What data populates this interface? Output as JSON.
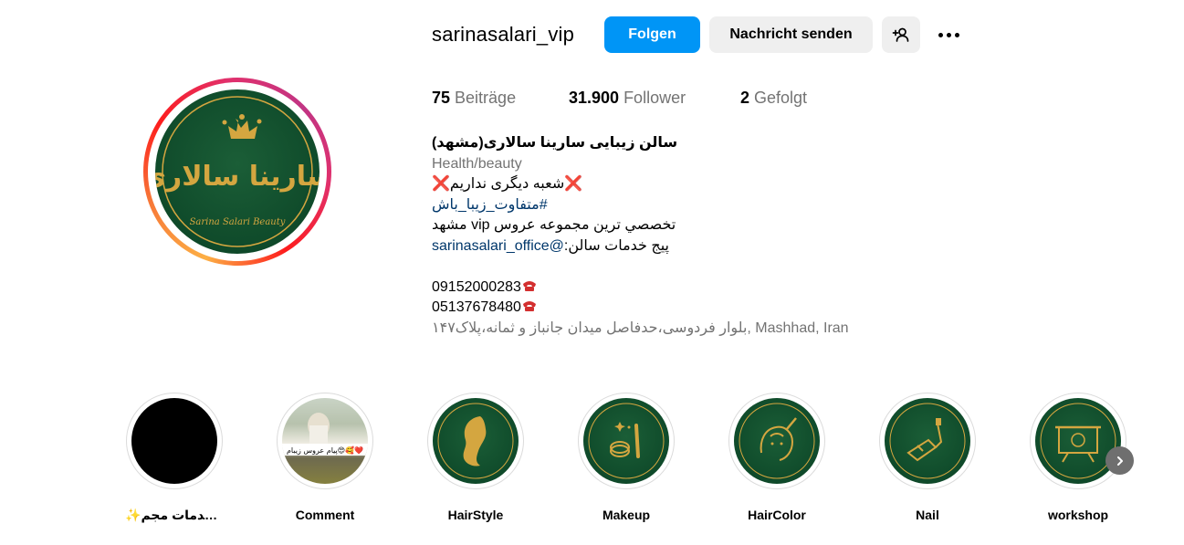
{
  "profile": {
    "username": "sarinasalari_vip",
    "follow_label": "Folgen",
    "message_label": "Nachricht senden",
    "suggest_icon": "person-plus-icon",
    "more_icon": "more-horizontal-icon",
    "avatar_text": "سارینا سالاری",
    "avatar_subtext": "Sarina Salari Beauty"
  },
  "stats": {
    "posts_count": "75",
    "posts_label": "Beiträge",
    "followers_count": "31.900",
    "followers_label": "Follower",
    "following_count": "2",
    "following_label": "Gefolgt"
  },
  "bio": {
    "name": "سالن زیبایی سارینا سالاری(مشهد)",
    "category": "Health/beauty",
    "line1_x": "❌",
    "line1_text": "شعبه دیگری نداریم",
    "hashtag": "#متفاوت_زیبا_باش",
    "line3": "تخصصي ترین مجموعه عروس vip مشهد",
    "line4_prefix": "پیج خدمات سالن:",
    "line4_link": "@sarinasalari_office",
    "phone1": "09152000283",
    "phone2": "05137678480",
    "address": "بلوار فردوسی،حدفاصل میدان جانباز و ثمانه،پلاک۱۴۷, Mashhad, Iran"
  },
  "highlights": [
    {
      "label": "✨خدمات مجم...",
      "icon": "black-cover"
    },
    {
      "label": "Comment",
      "icon": "photo-cover",
      "overlay": "پیام عروس زیبام😍🥰❤️"
    },
    {
      "label": "HairStyle",
      "icon": "hairstyle-icon"
    },
    {
      "label": "Makeup",
      "icon": "makeup-icon"
    },
    {
      "label": "HairColor",
      "icon": "haircolor-icon"
    },
    {
      "label": "Nail",
      "icon": "nail-icon"
    },
    {
      "label": "workshop",
      "icon": "workshop-icon"
    }
  ],
  "colors": {
    "primary_button": "#0095f6",
    "secondary_button": "#efefef",
    "brand_green": "#0f4a2a",
    "brand_gold": "#d4a640",
    "link": "#00376b",
    "muted": "#737373"
  }
}
